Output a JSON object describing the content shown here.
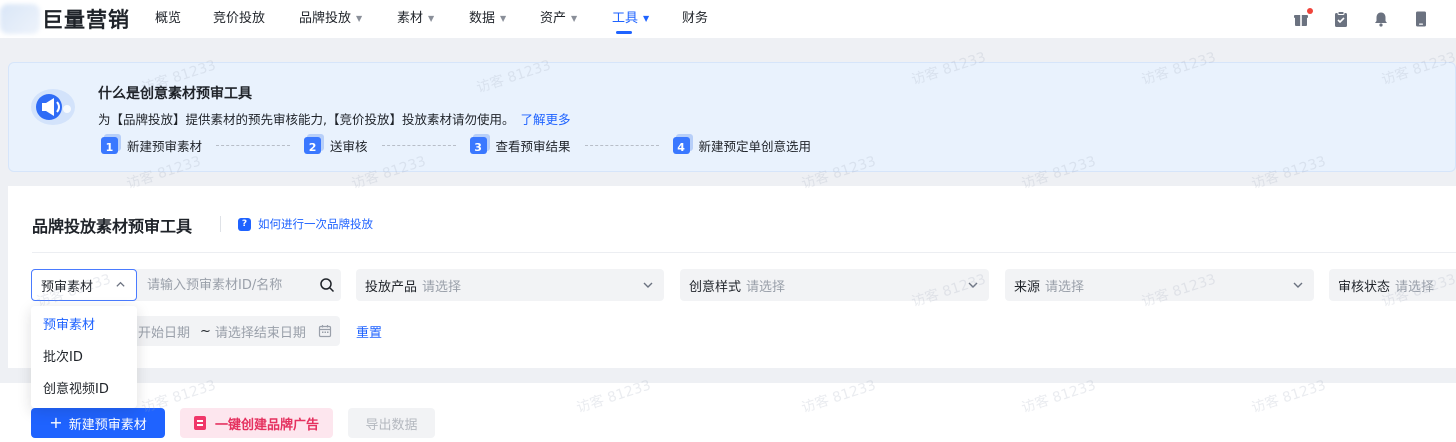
{
  "nav": {
    "logo_text": "巨量营销",
    "items": [
      {
        "label": "概览",
        "caret": false,
        "active": false
      },
      {
        "label": "竞价投放",
        "caret": false,
        "active": false
      },
      {
        "label": "品牌投放",
        "caret": true,
        "active": false
      },
      {
        "label": "素材",
        "caret": true,
        "active": false
      },
      {
        "label": "数据",
        "caret": true,
        "active": false
      },
      {
        "label": "资产",
        "caret": true,
        "active": false
      },
      {
        "label": "工具",
        "caret": true,
        "active": true
      },
      {
        "label": "财务",
        "caret": false,
        "active": false
      }
    ],
    "right_icons": [
      "gift-icon",
      "clipboard-icon",
      "bell-icon",
      "phone-icon"
    ],
    "accent_color": "#1f63ff"
  },
  "banner": {
    "title": "什么是创意素材预审工具",
    "desc": "为【品牌投放】提供素材的预先审核能力,【竞价投放】投放素材请勿使用。",
    "learn_more": "了解更多",
    "steps": [
      {
        "num": "1",
        "label": "新建预审素材"
      },
      {
        "num": "2",
        "label": "送审核"
      },
      {
        "num": "3",
        "label": "查看预审结果"
      },
      {
        "num": "4",
        "label": "新建预定单创意选用"
      }
    ]
  },
  "card": {
    "title": "品牌投放素材预审工具",
    "help_link": "如何进行一次品牌投放",
    "search": {
      "type_selected": "预审素材",
      "placeholder": "请输入预审素材ID/名称"
    },
    "filters": [
      {
        "label": "投放产品",
        "value": "请选择"
      },
      {
        "label": "创意样式",
        "value": "请选择"
      },
      {
        "label": "来源",
        "value": "请选择"
      },
      {
        "label": "审核状态",
        "value": "请选择"
      }
    ],
    "date": {
      "start": "开始日期",
      "tilde": "~",
      "end": "请选择结束日期"
    },
    "reset": "重置",
    "dropdown_options": [
      "预审素材",
      "批次ID",
      "创意视频ID"
    ]
  },
  "actions": {
    "new_material": "新建预审素材",
    "create_brand_ad": "一键创建品牌广告",
    "export": "导出数据"
  },
  "watermark": "访客 81233"
}
